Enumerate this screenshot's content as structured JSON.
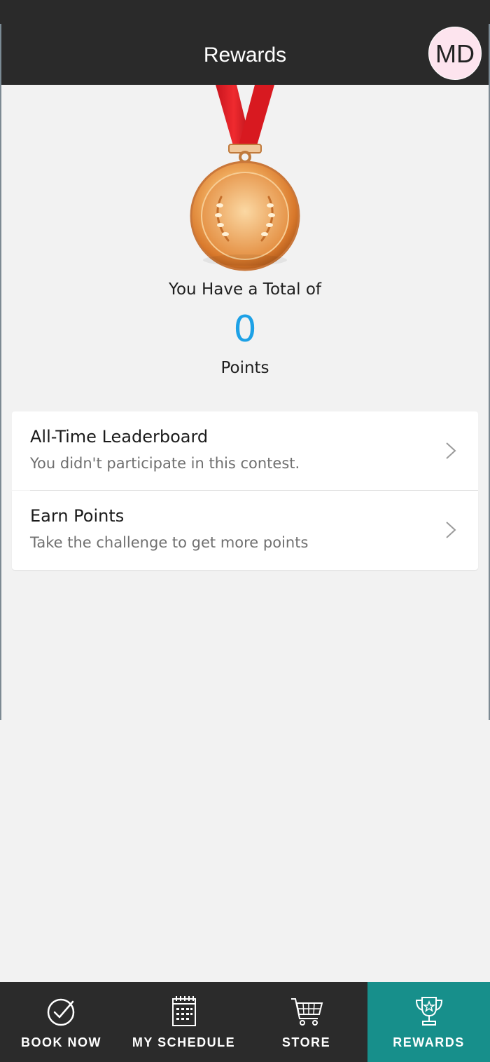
{
  "header": {
    "title": "Rewards",
    "avatar_initials": "MD",
    "avatar_color": "#fde4ee"
  },
  "summary": {
    "total_label": "You Have a Total of",
    "points_value": "0",
    "points_label": "Points",
    "accent_color": "#1da1e6"
  },
  "rewards_list": [
    {
      "title": "All-Time Leaderboard",
      "subtitle": "You didn't participate in this contest.",
      "icon": "chevron-right-icon"
    },
    {
      "title": "Earn Points",
      "subtitle": "Take the challenge to get more points",
      "icon": "chevron-right-icon"
    }
  ],
  "tabbar": {
    "active_color": "#178f8b",
    "tabs": [
      {
        "label": "BOOK NOW",
        "icon": "check-circle-icon",
        "active": false
      },
      {
        "label": "MY SCHEDULE",
        "icon": "calendar-icon",
        "active": false
      },
      {
        "label": "STORE",
        "icon": "cart-icon",
        "active": false
      },
      {
        "label": "REWARDS",
        "icon": "trophy-icon",
        "active": true
      }
    ]
  }
}
